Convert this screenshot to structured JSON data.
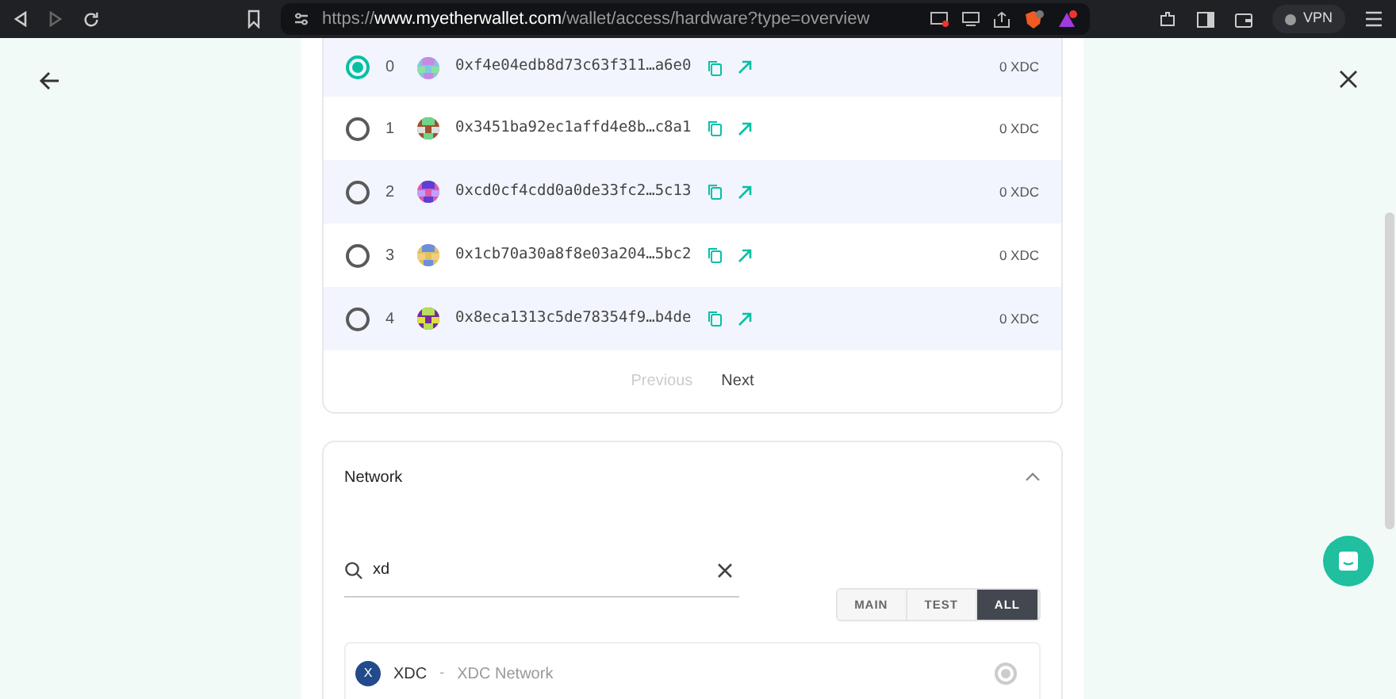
{
  "browser": {
    "url": "https://**www.myetherwallet.com**/wallet/access/hardware?type=overview",
    "vpn_label": "VPN"
  },
  "accounts": [
    {
      "index": "0",
      "address": "0xf4e04edb8d73c63f311…a6e0",
      "balance": "0 XDC",
      "selected": true
    },
    {
      "index": "1",
      "address": "0x3451ba92ec1affd4e8b…c8a1",
      "balance": "0 XDC",
      "selected": false
    },
    {
      "index": "2",
      "address": "0xcd0cf4cdd0a0de33fc2…5c13",
      "balance": "0 XDC",
      "selected": false
    },
    {
      "index": "3",
      "address": "0x1cb70a30a8f8e03a204…5bc2",
      "balance": "0 XDC",
      "selected": false
    },
    {
      "index": "4",
      "address": "0x8eca1313c5de78354f9…b4de",
      "balance": "0 XDC",
      "selected": false
    }
  ],
  "pagination": {
    "previous": {
      "label": "Previous",
      "disabled": true
    },
    "next": {
      "label": "Next",
      "disabled": false
    }
  },
  "network": {
    "title": "Network",
    "expanded": true,
    "search": {
      "value": "xd"
    },
    "filters": [
      {
        "label": "MAIN",
        "selected": false
      },
      {
        "label": "TEST",
        "selected": false
      },
      {
        "label": "ALL",
        "selected": true
      }
    ],
    "items": [
      {
        "badge": "X",
        "symbol": "XDC",
        "separator": "-",
        "name": "XDC Network",
        "selected": true
      }
    ]
  }
}
